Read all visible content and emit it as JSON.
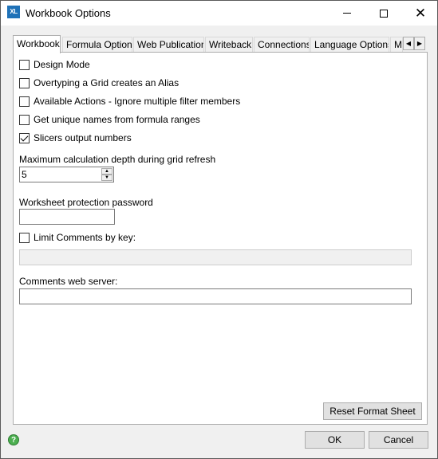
{
  "window": {
    "title": "Workbook Options",
    "app_icon": "XL"
  },
  "tabs": [
    {
      "label": "Workbook",
      "active": true
    },
    {
      "label": "Formula Options",
      "active": false
    },
    {
      "label": "Web Publication",
      "active": false
    },
    {
      "label": "Writeback",
      "active": false
    },
    {
      "label": "Connections",
      "active": false
    },
    {
      "label": "Language Options",
      "active": false
    },
    {
      "label": "M",
      "active": false
    }
  ],
  "tab_scroll": {
    "left": "◀",
    "right": "▶"
  },
  "checkboxes": [
    {
      "label": "Design Mode",
      "checked": false
    },
    {
      "label": "Overtyping a Grid creates an Alias",
      "checked": false
    },
    {
      "label": "Available Actions - Ignore multiple filter members",
      "checked": false
    },
    {
      "label": "Get unique names from formula ranges",
      "checked": false
    },
    {
      "label": "Slicers output numbers",
      "checked": true
    }
  ],
  "calc_depth": {
    "label": "Maximum calculation depth during grid refresh",
    "value": "5"
  },
  "protection": {
    "label": "Worksheet protection password",
    "value": ""
  },
  "limit_comments": {
    "label": "Limit Comments by key:",
    "checked": false,
    "value": ""
  },
  "comments_server": {
    "label": "Comments web server:",
    "value": ""
  },
  "buttons": {
    "reset": "Reset Format Sheet",
    "ok": "OK",
    "cancel": "Cancel"
  },
  "help": {
    "glyph": "?"
  }
}
